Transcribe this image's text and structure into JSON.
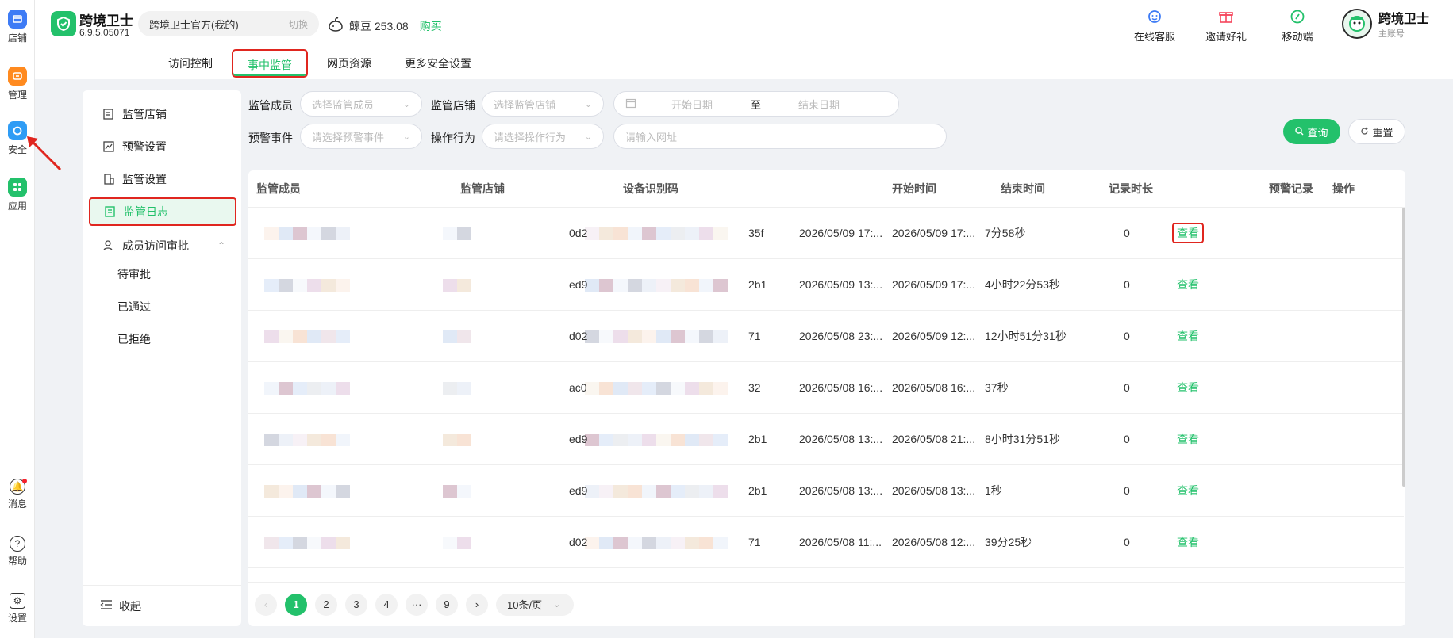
{
  "app": {
    "name": "跨境卫士",
    "version": "6.9.5.05071"
  },
  "org": {
    "name": "跨境卫士官方(我的)",
    "switch_label": "切换"
  },
  "coins": {
    "label": "鲸豆 253.08",
    "buy_label": "购买"
  },
  "rail": {
    "top": [
      {
        "label": "店铺",
        "icon": "store-icon",
        "color": "#3d7bf5"
      },
      {
        "label": "管理",
        "icon": "manage-icon",
        "color": "#ff8a1f"
      },
      {
        "label": "安全",
        "icon": "security-icon",
        "color": "#2f9cf5"
      },
      {
        "label": "应用",
        "icon": "apps-icon",
        "color": "#23c16b"
      }
    ],
    "bottom": [
      {
        "label": "消息",
        "icon": "bell-icon"
      },
      {
        "label": "帮助",
        "icon": "help-icon"
      },
      {
        "label": "设置",
        "icon": "gear-icon"
      }
    ]
  },
  "tabs": [
    "访问控制",
    "事中监管",
    "网页资源",
    "更多安全设置"
  ],
  "active_tab": 1,
  "quick": [
    {
      "label": "在线客服",
      "icon": "support-icon",
      "color": "#3d7bf5"
    },
    {
      "label": "邀请好礼",
      "icon": "gift-icon",
      "color": "#f5455c"
    },
    {
      "label": "移动端",
      "icon": "mobile-icon",
      "color": "#23c16b"
    }
  ],
  "profile": {
    "name": "跨境卫士",
    "role": "主账号"
  },
  "sidebar": {
    "items": [
      "监管店铺",
      "预警设置",
      "监管设置",
      "监管日志",
      "成员访问审批"
    ],
    "subitems": [
      "待审批",
      "已通过",
      "已拒绝"
    ],
    "collapse_label": "收起"
  },
  "filters": {
    "member_label": "监管成员",
    "member_placeholder": "选择监管成员",
    "store_label": "监管店铺",
    "store_placeholder": "选择监管店铺",
    "start_placeholder": "开始日期",
    "to_label": "至",
    "end_placeholder": "结束日期",
    "event_label": "预警事件",
    "event_placeholder": "请选择预警事件",
    "action_label": "操作行为",
    "action_placeholder": "请选择操作行为",
    "url_placeholder": "请输入网址",
    "query_label": "查询",
    "reset_label": "重置"
  },
  "table": {
    "columns": [
      "监管成员",
      "监管店铺",
      "设备识别码",
      "开始时间",
      "结束时间",
      "记录时长",
      "预警记录",
      "操作"
    ],
    "rows": [
      {
        "device_prefix": "0d2",
        "device_suffix": "35f",
        "start": "2026/05/09 17:...",
        "end": "2026/05/09 17:...",
        "duration": "7分58秒",
        "alerts": "0",
        "action": "查看"
      },
      {
        "device_prefix": "ed9",
        "device_suffix": "2b1",
        "start": "2026/05/09 13:...",
        "end": "2026/05/09 17:...",
        "duration": "4小时22分53秒",
        "alerts": "0",
        "action": "查看"
      },
      {
        "device_prefix": "d02",
        "device_suffix": "71",
        "start": "2026/05/08 23:...",
        "end": "2026/05/09 12:...",
        "duration": "12小时51分31秒",
        "alerts": "0",
        "action": "查看"
      },
      {
        "device_prefix": "ac0",
        "device_suffix": "32",
        "start": "2026/05/08 16:...",
        "end": "2026/05/08 16:...",
        "duration": "37秒",
        "alerts": "0",
        "action": "查看"
      },
      {
        "device_prefix": "ed9",
        "device_suffix": "2b1",
        "start": "2026/05/08 13:...",
        "end": "2026/05/08 21:...",
        "duration": "8小时31分51秒",
        "alerts": "0",
        "action": "查看"
      },
      {
        "device_prefix": "ed9",
        "device_suffix": "2b1",
        "start": "2026/05/08 13:...",
        "end": "2026/05/08 13:...",
        "duration": "1秒",
        "alerts": "0",
        "action": "查看"
      },
      {
        "device_prefix": "d02",
        "device_suffix": "71",
        "start": "2026/05/08 11:...",
        "end": "2026/05/08 12:...",
        "duration": "39分25秒",
        "alerts": "0",
        "action": "查看"
      }
    ]
  },
  "pagination": {
    "pages": [
      "1",
      "2",
      "3",
      "4",
      "···",
      "9"
    ],
    "current": "1",
    "page_size": "10条/页"
  }
}
